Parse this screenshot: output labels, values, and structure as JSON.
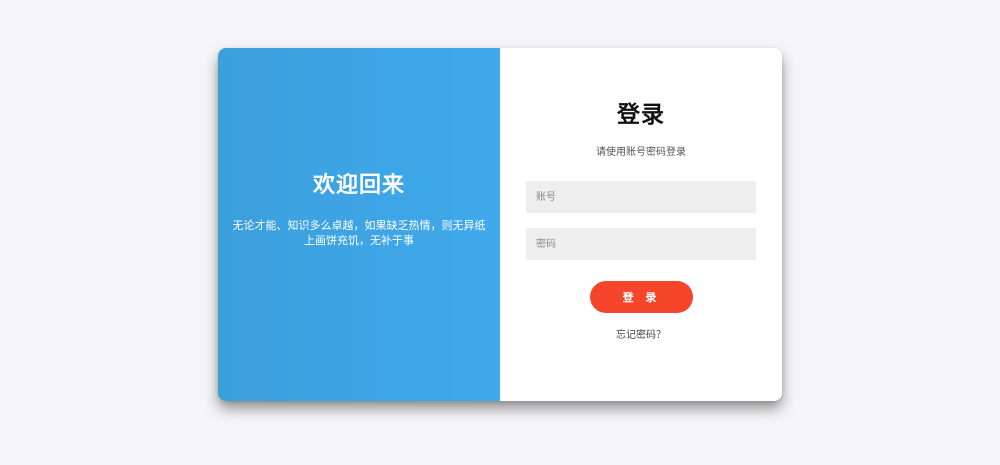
{
  "welcome": {
    "title": "欢迎回来",
    "text": "无论才能、知识多么卓越，如果缺乏热情，则无异纸上画饼充饥，无补于事"
  },
  "login": {
    "title": "登录",
    "subtitle": "请使用账号密码登录",
    "account_placeholder": "账号",
    "password_placeholder": "密码",
    "button_label": "登 录",
    "forgot_label": "忘记密码？"
  },
  "colors": {
    "left_panel": "#3da5e6",
    "button": "#f5452a",
    "input_bg": "#eeeeee",
    "page_bg": "#f5f5f7"
  }
}
